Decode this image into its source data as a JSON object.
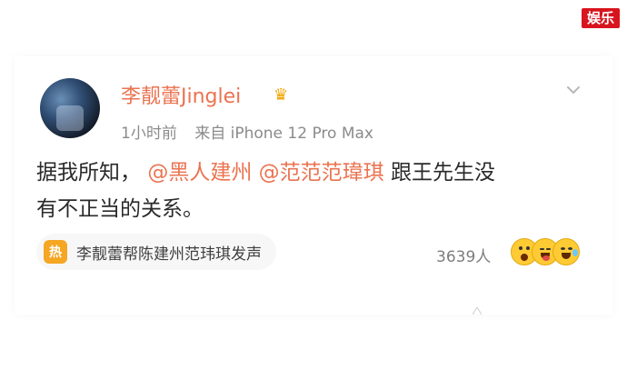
{
  "watermark": "娱乐",
  "user": {
    "name": "李靓蕾Jinglei",
    "avatar_icon": "profile-photo",
    "badge_icon": "crown-icon"
  },
  "post": {
    "time": "1小时前",
    "source": "来自 iPhone 12 Pro Max",
    "content_pre": "据我所知，",
    "mention_1": "@黑人建州",
    "mention_2": "@范范范瑋琪",
    "content_mid": "跟王先生没",
    "content_line2": "有不正当的关系。"
  },
  "topic": {
    "icon_text": "热",
    "text": "李靓蕾帮陈建州范玮琪发声"
  },
  "reactions": {
    "count": "3639人",
    "emoji_icons": [
      "surprised-face-icon",
      "laughing-face-icon",
      "grinning-face-icon"
    ]
  }
}
